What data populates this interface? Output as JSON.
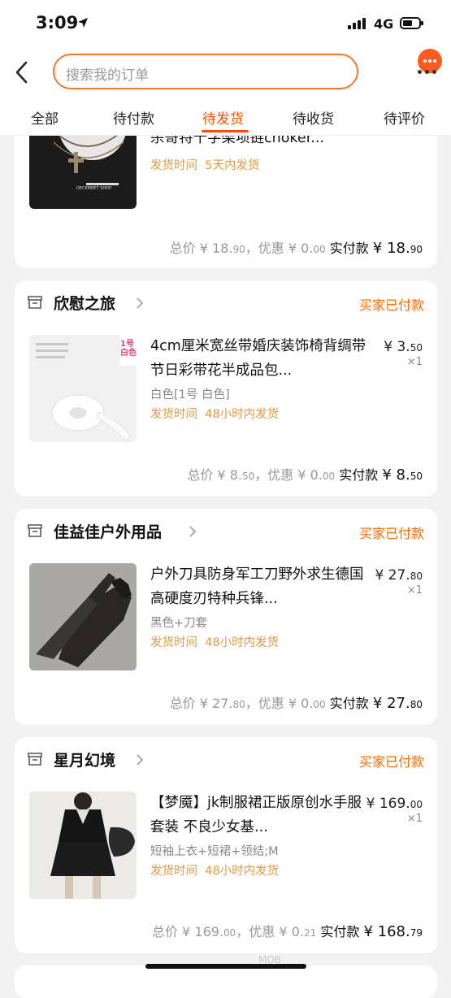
{
  "status_bar": {
    "time": "3:09",
    "network": "4G"
  },
  "header": {
    "search_placeholder": "搜索我的订单"
  },
  "tabs": [
    {
      "label": "全部",
      "active": false
    },
    {
      "label": "待付款",
      "active": false
    },
    {
      "label": "待发货",
      "active": true
    },
    {
      "label": "待收货",
      "active": false
    },
    {
      "label": "待评价",
      "active": false
    }
  ],
  "orders": [
    {
      "title_line2": "杀哥特十字架项链choker...",
      "ship_label": "发货时间",
      "ship_value": "5天内发货",
      "thumb_text": "DECEMBET SHOP",
      "totals": {
        "total_label": "总价",
        "total_int": "¥ 18.",
        "total_dec": "90",
        "disc_label": "，优惠",
        "disc_int": "¥ 0.",
        "disc_dec": "00",
        "paid_label": "实付款",
        "paid_int": "¥ 18.",
        "paid_dec": "90"
      }
    },
    {
      "shop": "欣慰之旅",
      "status": "买家已付款",
      "title": "4cm厘米宽丝带婚庆装饰椅背绸带节日彩带花半成品包...",
      "variant": "白色[1号 白色]",
      "ship_label": "发货时间",
      "ship_value": "48小时内发货",
      "price_int": "¥ 3.",
      "price_dec": "50",
      "qty": "×1",
      "thumb_badge": "1号\n白色",
      "totals": {
        "total_label": "总价",
        "total_int": "¥ 8.",
        "total_dec": "50",
        "disc_label": "，优惠",
        "disc_int": "¥ 0.",
        "disc_dec": "00",
        "paid_label": "实付款",
        "paid_int": "¥ 8.",
        "paid_dec": "50"
      }
    },
    {
      "shop": "佳益佳户外用品",
      "status": "买家已付款",
      "title": "户外刀具防身军工刀野外求生德国高硬度刃特种兵锋...",
      "variant": "黑色+刀套",
      "ship_label": "发货时间",
      "ship_value": "48小时内发货",
      "price_int": "¥ 27.",
      "price_dec": "80",
      "qty": "×1",
      "totals": {
        "total_label": "总价",
        "total_int": "¥ 27.",
        "total_dec": "80",
        "disc_label": "，优惠",
        "disc_int": "¥ 0.",
        "disc_dec": "00",
        "paid_label": "实付款",
        "paid_int": "¥ 27.",
        "paid_dec": "80"
      }
    },
    {
      "shop": "星月幻境",
      "status": "买家已付款",
      "title": "【梦魇】jk制服裙正版原创水手服套装 不良少女基...",
      "variant": "短袖上衣+短裙+领结;M",
      "ship_label": "发货时间",
      "ship_value": "48小时内发货",
      "price_int": "¥ 169.",
      "price_dec": "00",
      "qty": "×1",
      "totals": {
        "total_label": "总价",
        "total_int": "¥ 169.",
        "total_dec": "00",
        "disc_label": "，优惠",
        "disc_int": "¥ 0.",
        "disc_dec": "21",
        "paid_label": "实付款",
        "paid_int": "¥ 168.",
        "paid_dec": "79"
      }
    }
  ],
  "watermark": "MOB"
}
